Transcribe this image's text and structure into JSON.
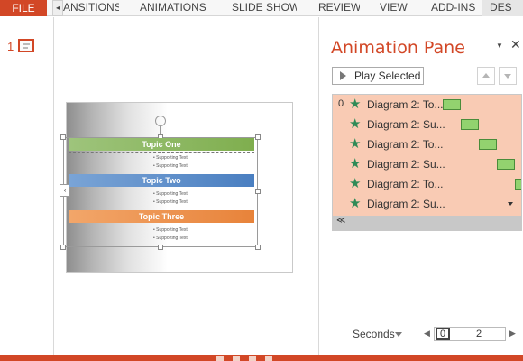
{
  "ribbon": {
    "file_tab": "FILE",
    "tabs": [
      "ANSITIONS",
      "ANIMATIONS",
      "SLIDE SHOW",
      "REVIEW",
      "VIEW",
      "ADD-INS",
      "DES"
    ],
    "scroll_left_icon": "◂"
  },
  "thumbnails": {
    "slide_number": "1"
  },
  "slide": {
    "topics": [
      "Topic One",
      "Topic Two",
      "Topic Three"
    ],
    "supporting_text": "Supporting Text",
    "left_arrow_icon": "‹"
  },
  "pane": {
    "title": "Animation Pane",
    "menu_icon": "▼",
    "close_icon": "✕",
    "play_label": "Play Selected",
    "rows": [
      {
        "num": "0",
        "label": "Diagram 2: To..."
      },
      {
        "num": "",
        "label": "Diagram 2: Su..."
      },
      {
        "num": "",
        "label": "Diagram 2: To..."
      },
      {
        "num": "",
        "label": "Diagram 2: Su..."
      },
      {
        "num": "",
        "label": "Diagram 2: To..."
      },
      {
        "num": "",
        "label": "Diagram 2: Su..."
      }
    ],
    "star_icon": "★",
    "collapse_icon": "≪",
    "seconds_label": "Seconds",
    "timeline_start": "0",
    "timeline_mark": "2",
    "prev_icon": "◀",
    "next_icon": "▶"
  },
  "colors": {
    "accent": "#d24726",
    "list_bg": "#f9cbb4",
    "timing_bar": "#92d26f"
  }
}
